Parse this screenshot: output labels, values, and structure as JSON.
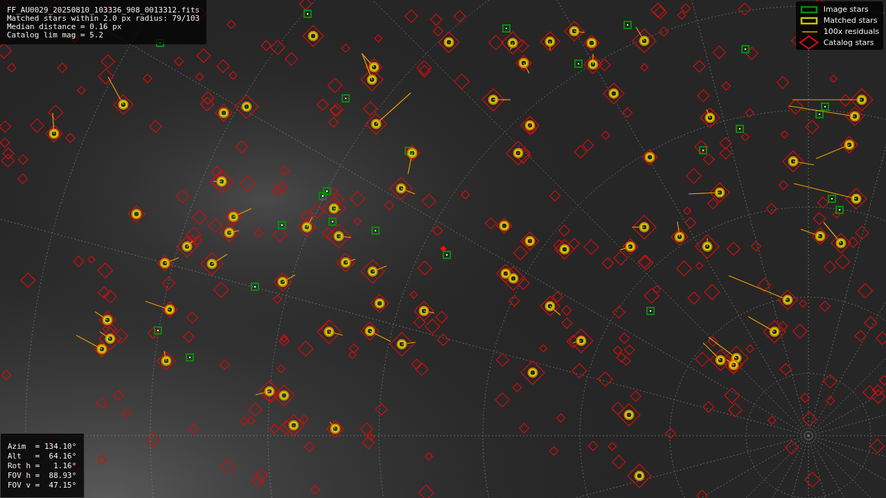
{
  "header": {
    "lines": [
      "FF_AU0029_20250810_103336_908_0013312.fits",
      "Matched stars within 2.0 px radius: 79/103",
      "Median distance = 0.16 px",
      "Catalog lim mag = 5.2"
    ]
  },
  "legend": [
    {
      "kind": "image",
      "label": "Image stars"
    },
    {
      "kind": "matched",
      "label": "Matched stars"
    },
    {
      "kind": "residual",
      "label": "100x residuals"
    },
    {
      "kind": "catalog",
      "label": "Catalog stars"
    }
  ],
  "pointing": {
    "lines": [
      "Azim  = 134.10°",
      "Alt   =  64.16°",
      "Rot h =   1.16°",
      "FOV h =  88.93°",
      "FOV v =  47.15°"
    ]
  }
}
